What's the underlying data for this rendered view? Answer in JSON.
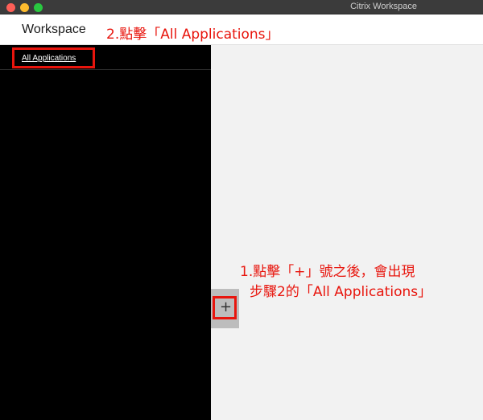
{
  "window": {
    "title": "Citrix Workspace"
  },
  "app": {
    "name": "Workspace"
  },
  "annotations": {
    "step2": "2.點擊「All Applications」",
    "step1_line1": "1.點擊「+」號之後，會出現",
    "step1_line2": "步驟2的「All Applications」",
    "highlight_color": "#e8150d"
  },
  "sidebar": {
    "link_label": "All Applications"
  },
  "expand": {
    "symbol": "+",
    "icon": "plus-icon"
  },
  "colors": {
    "sidebar_bg": "#000000",
    "content_bg": "#f2f2f2",
    "titlebar_bg": "#3b3b3b"
  }
}
